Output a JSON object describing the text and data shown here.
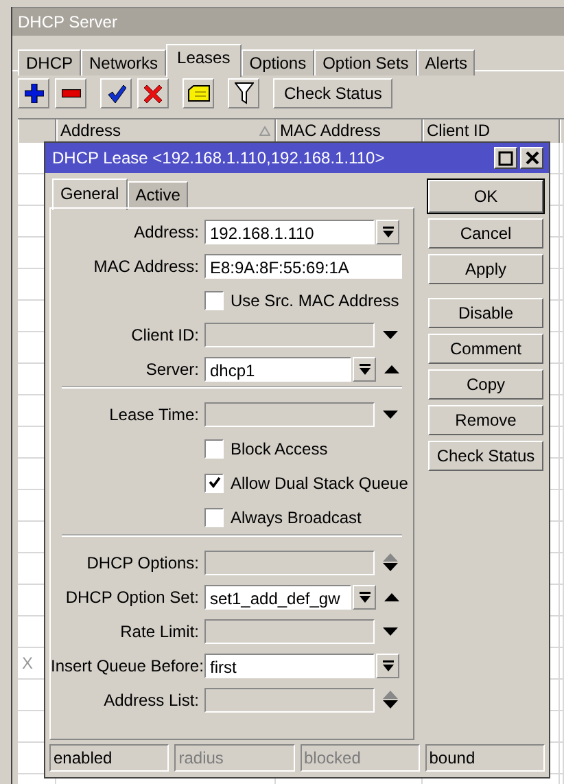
{
  "window": {
    "title": "DHCP Server"
  },
  "tabs": [
    {
      "label": "DHCP",
      "selected": false
    },
    {
      "label": "Networks",
      "selected": false
    },
    {
      "label": "Leases",
      "selected": true
    },
    {
      "label": "Options",
      "selected": false
    },
    {
      "label": "Option Sets",
      "selected": false
    },
    {
      "label": "Alerts",
      "selected": false
    }
  ],
  "toolbar": {
    "check_status": "Check Status"
  },
  "table": {
    "columns": [
      {
        "label": "Address",
        "sorted": true
      },
      {
        "label": "MAC Address",
        "sorted": false
      },
      {
        "label": "Client ID",
        "sorted": false
      }
    ],
    "rows": [
      {},
      {},
      {},
      {},
      {},
      {},
      {},
      {},
      {},
      {},
      {},
      {},
      {},
      {},
      {},
      {},
      {
        "flag": "X"
      },
      {},
      {},
      {},
      {}
    ]
  },
  "dialog": {
    "title": "DHCP Lease <192.168.1.110,192.168.1.110>",
    "tabs": [
      {
        "label": "General",
        "selected": true
      },
      {
        "label": "Active",
        "selected": false
      }
    ],
    "rows": [
      {
        "kind": "field",
        "label": "Address:",
        "value": "192.168.1.110",
        "editable": true,
        "button": true,
        "up_arrow": false,
        "down_arrow": false
      },
      {
        "kind": "field",
        "label": "MAC Address:",
        "value": "E8:9A:8F:55:69:1A",
        "editable": true,
        "button": false,
        "up_arrow": false,
        "down_arrow": false
      },
      {
        "kind": "checkbox",
        "label": "Use Src. MAC Address",
        "checked": false
      },
      {
        "kind": "field",
        "label": "Client ID:",
        "editable": false,
        "button": false,
        "up_arrow": false,
        "down_arrow": true
      },
      {
        "kind": "field",
        "label": "Server:",
        "value": "dhcp1",
        "editable": true,
        "button": true,
        "up_arrow": true,
        "down_arrow": false
      },
      {
        "kind": "separator"
      },
      {
        "kind": "field",
        "label": "Lease Time:",
        "editable": false,
        "button": false,
        "up_arrow": false,
        "down_arrow": true
      },
      {
        "kind": "checkbox",
        "label": "Block Access",
        "checked": false
      },
      {
        "kind": "checkbox",
        "label": "Allow Dual Stack Queue",
        "checked": true
      },
      {
        "kind": "checkbox",
        "label": "Always Broadcast",
        "checked": false
      },
      {
        "kind": "separator"
      },
      {
        "kind": "field",
        "label": "DHCP Options:",
        "editable": false,
        "button": false,
        "up_arrow": true,
        "down_arrow": true
      },
      {
        "kind": "field",
        "label": "DHCP Option Set:",
        "value": "set1_add_def_gw",
        "editable": true,
        "button": true,
        "up_arrow": true,
        "down_arrow": false
      },
      {
        "kind": "field",
        "label": "Rate Limit:",
        "editable": false,
        "button": false,
        "up_arrow": false,
        "down_arrow": true
      },
      {
        "kind": "field",
        "label": "Insert Queue Before:",
        "value": "first",
        "editable": true,
        "button": true,
        "up_arrow": false,
        "down_arrow": false
      },
      {
        "kind": "field",
        "label": "Address List:",
        "editable": false,
        "button": false,
        "up_arrow": true,
        "down_arrow": true
      }
    ],
    "buttons_top": [
      {
        "label": "OK",
        "default": true
      },
      {
        "label": "Cancel",
        "default": false
      },
      {
        "label": "Apply",
        "default": false
      }
    ],
    "buttons_bottom": [
      {
        "label": "Disable",
        "default": false
      },
      {
        "label": "Comment",
        "default": false
      },
      {
        "label": "Copy",
        "default": false
      },
      {
        "label": "Remove",
        "default": false
      },
      {
        "label": "Check Status",
        "default": false
      }
    ],
    "status": [
      {
        "text": "enabled",
        "disabled": false
      },
      {
        "text": "radius",
        "disabled": true
      },
      {
        "text": "blocked",
        "disabled": true
      },
      {
        "text": "bound",
        "disabled": false
      }
    ]
  }
}
